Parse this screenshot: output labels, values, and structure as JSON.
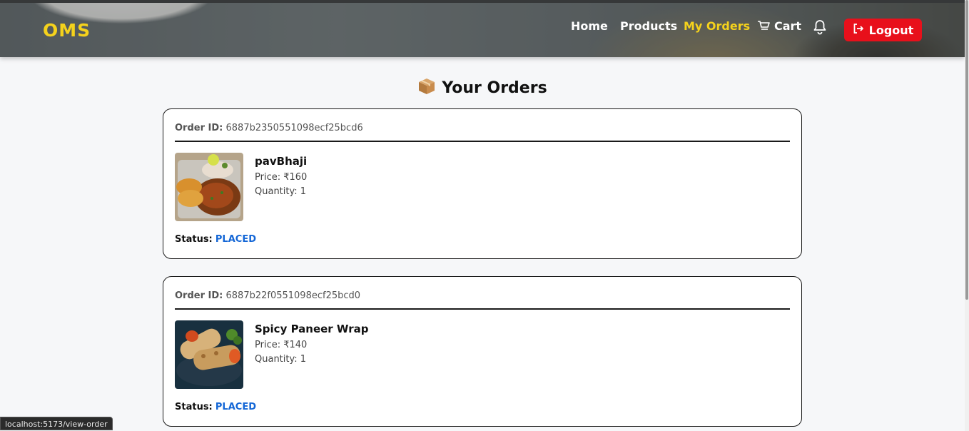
{
  "brand": "OMS",
  "nav": {
    "home": "Home",
    "products": "Products",
    "my_orders": "My Orders",
    "cart": "Cart",
    "logout": "Logout"
  },
  "page_title": "Your Orders",
  "labels": {
    "order_id": "Order ID:",
    "status": "Status:"
  },
  "orders": [
    {
      "id": "6887b2350551098ecf25bcd6",
      "item_name": "pavBhaji",
      "price": "Price: ₹160",
      "quantity": "Quantity: 1",
      "status": "PLACED"
    },
    {
      "id": "6887b22f0551098ecf25bcd0",
      "item_name": "Spicy Paneer Wrap",
      "price": "Price: ₹140",
      "quantity": "Quantity: 1",
      "status": "PLACED"
    }
  ],
  "status_bar_url": "localhost:5173/view-order",
  "colors": {
    "brand": "#f5d21c",
    "active_nav": "#f5d21c",
    "logout_bg": "#e8101b",
    "status_text": "#1366d6"
  }
}
